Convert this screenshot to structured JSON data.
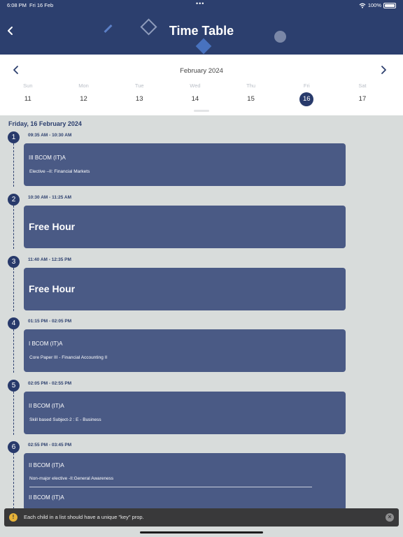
{
  "status_bar": {
    "time": "6:08 PM",
    "date": "Fri 16 Feb",
    "dots": "•••",
    "battery": "100%"
  },
  "header": {
    "title": "Time Table",
    "back_icon": "chevron-left-icon"
  },
  "calendar": {
    "month": "February 2024",
    "prev_icon": "chevron-left-icon",
    "next_icon": "chevron-right-icon",
    "days": [
      {
        "name": "Sun",
        "num": "11"
      },
      {
        "name": "Mon",
        "num": "12"
      },
      {
        "name": "Tue",
        "num": "13"
      },
      {
        "name": "Wed",
        "num": "14"
      },
      {
        "name": "Thu",
        "num": "15"
      },
      {
        "name": "Fri",
        "num": "16",
        "selected": true
      },
      {
        "name": "Sat",
        "num": "17"
      }
    ]
  },
  "schedule": {
    "date_heading": "Friday, 16 February 2024",
    "slots": [
      {
        "num": "1",
        "time": "09:35 AM - 10:30 AM",
        "entries": [
          {
            "class": "III BCOM (IT)A",
            "subject": "Elective –II: Financial Markets"
          }
        ]
      },
      {
        "num": "2",
        "time": "10:30 AM - 11:25 AM",
        "free": "Free Hour"
      },
      {
        "num": "3",
        "time": "11:40 AM - 12:35 PM",
        "free": "Free Hour"
      },
      {
        "num": "4",
        "time": "01:15 PM - 02:05 PM",
        "entries": [
          {
            "class": "I BCOM (IT)A",
            "subject": "Core Paper III - Financial Accounting II"
          }
        ]
      },
      {
        "num": "5",
        "time": "02:05 PM - 02:55 PM",
        "entries": [
          {
            "class": "II BCOM (IT)A",
            "subject": "Skill based Subject-2 : E - Business"
          }
        ]
      },
      {
        "num": "6",
        "time": "02:55 PM - 03:45 PM",
        "entries": [
          {
            "class": "II BCOM (IT)A",
            "subject": "Non-major elective -II:General Awareness"
          },
          {
            "class": "II BCOM (IT)A",
            "subject": ""
          }
        ]
      }
    ]
  },
  "toast": {
    "icon": "!",
    "message": "Each child in a list should have a unique \"key\" prop.",
    "close": "×"
  },
  "colors": {
    "header": "#2c3f6e",
    "card": "#4a5a85",
    "selected_day": "#283a6b",
    "background": "#d8dcdb"
  }
}
